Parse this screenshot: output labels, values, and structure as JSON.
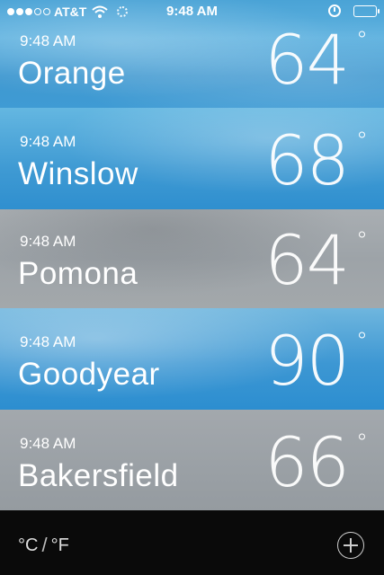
{
  "status_bar": {
    "carrier": "AT&T",
    "time": "9:48 AM",
    "signal_filled": 3,
    "signal_total": 5
  },
  "cities": [
    {
      "time": "9:48 AM",
      "name": "Orange",
      "temp": "64",
      "deg": "°"
    },
    {
      "time": "9:48 AM",
      "name": "Winslow",
      "temp": "68",
      "deg": "°"
    },
    {
      "time": "9:48 AM",
      "name": "Pomona",
      "temp": "64",
      "deg": "°"
    },
    {
      "time": "9:48 AM",
      "name": "Goodyear",
      "temp": "90",
      "deg": "°"
    },
    {
      "time": "9:48 AM",
      "name": "Bakersfield",
      "temp": "66",
      "deg": "°"
    }
  ],
  "bottom_bar": {
    "celsius": "°C",
    "slash": "/",
    "fahrenheit": "°F"
  },
  "icons": [
    "wifi-icon",
    "activity-spinner-icon",
    "alarm-icon",
    "battery-icon",
    "add-icon"
  ]
}
